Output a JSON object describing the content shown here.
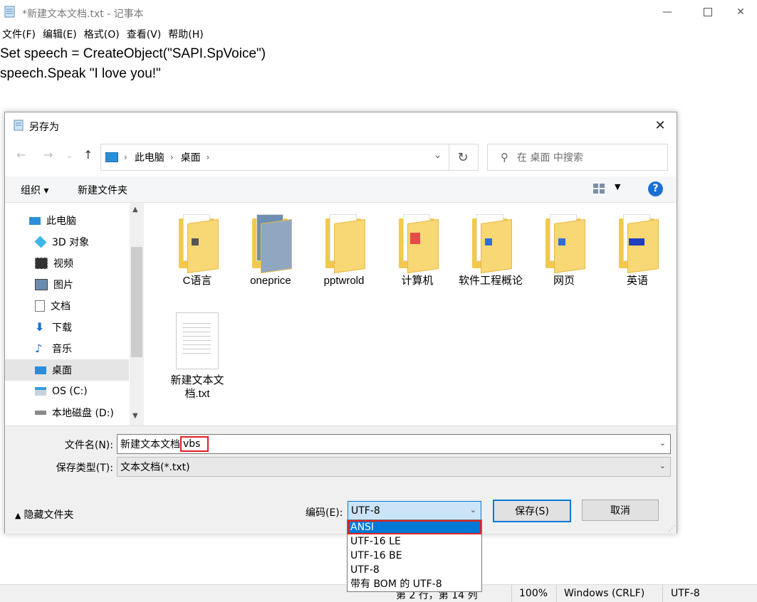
{
  "notepad": {
    "title": "*新建文本文档.txt - 记事本",
    "menu": [
      "文件(F)",
      "编辑(E)",
      "格式(O)",
      "查看(V)",
      "帮助(H)"
    ],
    "lines": [
      "Set speech = CreateObject(\"SAPI.SpVoice\")",
      "speech.Speak \"I love you!\""
    ],
    "status": {
      "position": "第 2 行，第 14 列",
      "zoom": "100%",
      "eol": "Windows (CRLF)",
      "encoding": "UTF-8"
    }
  },
  "dialog": {
    "title": "另存为",
    "breadcrumb": [
      "此电脑",
      "桌面"
    ],
    "search_placeholder": "在 桌面 中搜索",
    "toolbar": {
      "organize": "组织 ▾",
      "new_folder": "新建文件夹"
    },
    "nav": [
      {
        "label": "此电脑",
        "icon": "pc-icon"
      },
      {
        "label": "3D 对象",
        "icon": "cube-icon"
      },
      {
        "label": "视频",
        "icon": "video-icon"
      },
      {
        "label": "图片",
        "icon": "picture-icon"
      },
      {
        "label": "文档",
        "icon": "document-icon"
      },
      {
        "label": "下载",
        "icon": "download-icon"
      },
      {
        "label": "音乐",
        "icon": "music-icon"
      },
      {
        "label": "桌面",
        "icon": "desktop-icon"
      },
      {
        "label": "OS (C:)",
        "icon": "drive-icon"
      },
      {
        "label": "本地磁盘 (D:)",
        "icon": "drive-icon"
      }
    ],
    "files": [
      {
        "name": "C语言",
        "type": "folder"
      },
      {
        "name": "oneprice",
        "type": "folder"
      },
      {
        "name": "pptwrold",
        "type": "folder"
      },
      {
        "name": "计算机",
        "type": "folder"
      },
      {
        "name": "软件工程概论",
        "type": "folder"
      },
      {
        "name": "网页",
        "type": "folder"
      },
      {
        "name": "英语",
        "type": "folder"
      },
      {
        "name": "新建文本文档.txt",
        "type": "text-file"
      }
    ],
    "filename_label": "文件名(N):",
    "filename_base": "新建文本文档",
    "filename_ext": "vbs",
    "filetype_label": "保存类型(T):",
    "filetype_value": "文本文档(*.txt)",
    "hide_folders": "隐藏文件夹",
    "encoding_label": "编码(E):",
    "encoding_value": "UTF-8",
    "save": "保存(S)",
    "cancel": "取消",
    "encoding_options": [
      "ANSI",
      "UTF-16 LE",
      "UTF-16 BE",
      "UTF-8",
      "带有 BOM 的 UTF-8"
    ]
  }
}
